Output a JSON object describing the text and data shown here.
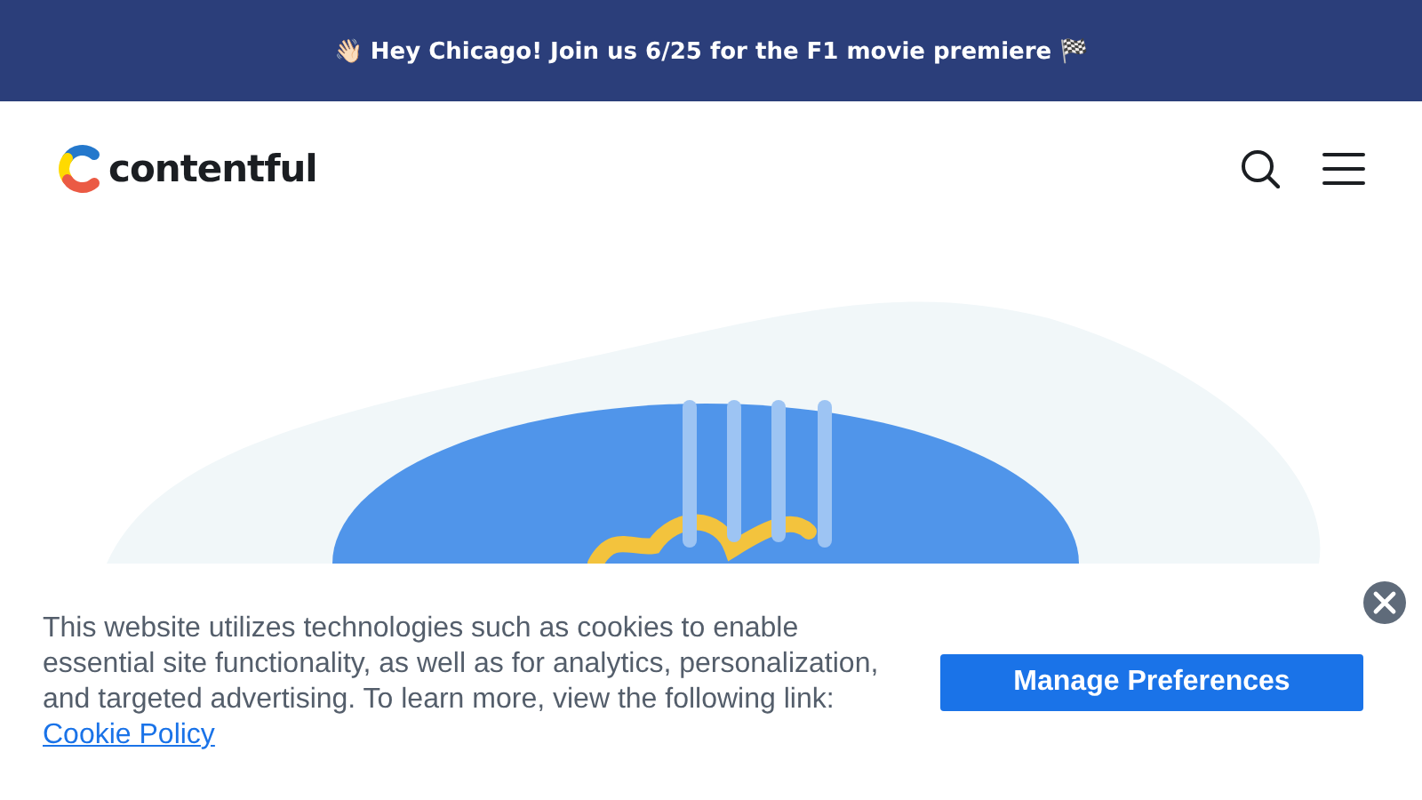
{
  "announcement": {
    "text": "👋🏻 Hey Chicago! Join us 6/25 for the F1 movie premiere 🏁"
  },
  "header": {
    "logo_text": "contentful"
  },
  "cookie_banner": {
    "message": "This website utilizes technologies such as cookies to enable essential site functionality, as well as for analytics, personalization, and targeted advertising. To learn more, view the following link:",
    "link": "Cookie Policy",
    "button": "Manage Preferences"
  }
}
